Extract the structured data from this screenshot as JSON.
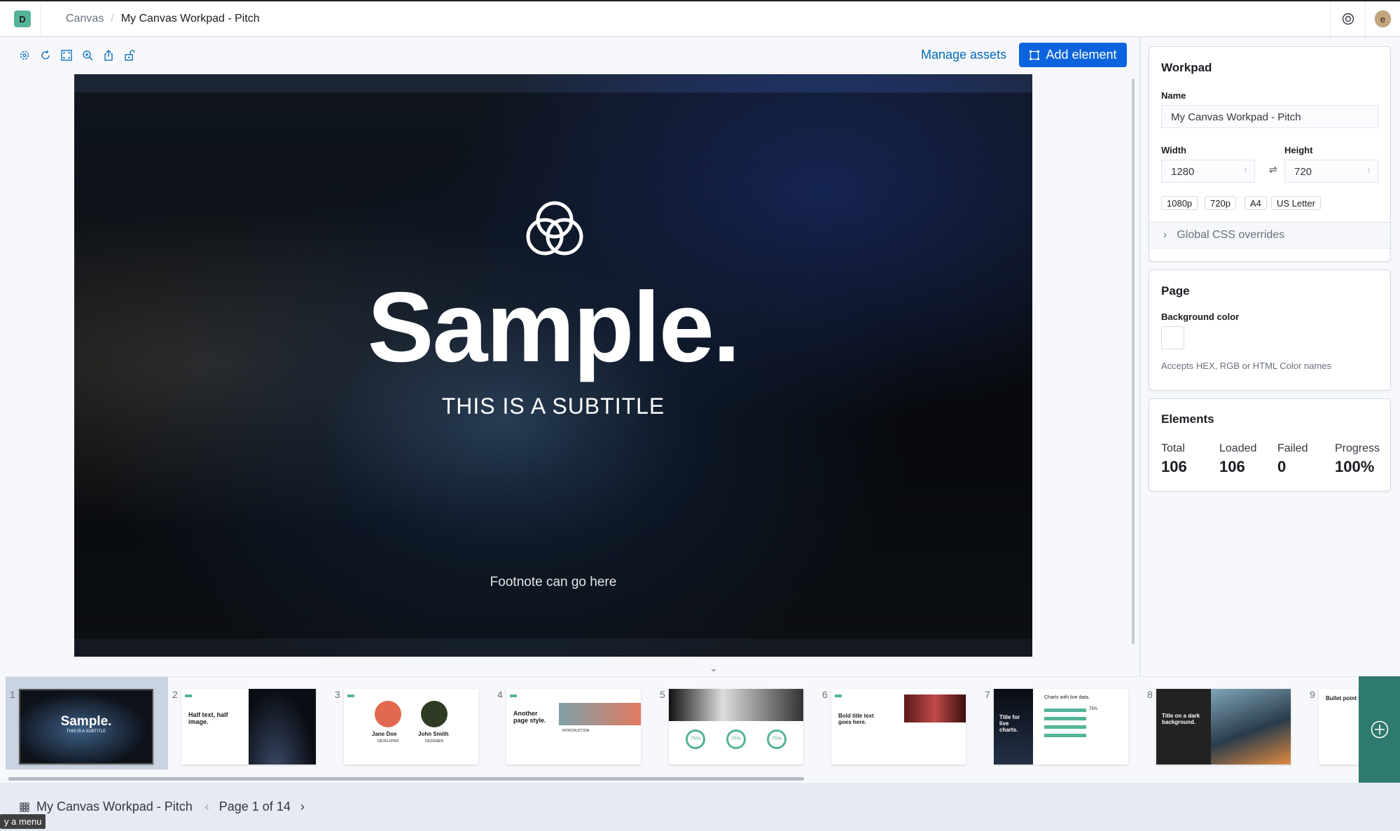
{
  "header": {
    "logo_letter": "D",
    "breadcrumbs": [
      "Canvas",
      "My Canvas Workpad - Pitch"
    ],
    "avatar_letter": "e"
  },
  "toolbar": {
    "icons": [
      "gear-icon",
      "refresh-icon",
      "fullscreen-icon",
      "zoom-in-icon",
      "share-icon",
      "lock-icon"
    ],
    "manage_assets": "Manage assets",
    "add_element": "Add element",
    "accent": "#0b64dd"
  },
  "slide": {
    "title": "Sample.",
    "subtitle": "THIS IS A SUBTITLE",
    "footnote": "Footnote can go here"
  },
  "workpad": {
    "title": "Workpad",
    "name_label": "Name",
    "name_value": "My Canvas Workpad - Pitch",
    "width_label": "Width",
    "width_value": "1280",
    "height_label": "Height",
    "height_value": "720",
    "presets": [
      "1080p",
      "720p",
      "A4",
      "US Letter"
    ],
    "css_overrides": "Global CSS overrides"
  },
  "page": {
    "title": "Page",
    "bg_label": "Background color",
    "bg_help": "Accepts HEX, RGB or HTML Color names",
    "bg_value": "#ffffff"
  },
  "elements": {
    "title": "Elements",
    "stats": [
      {
        "label": "Total",
        "value": "106"
      },
      {
        "label": "Loaded",
        "value": "106"
      },
      {
        "label": "Failed",
        "value": "0"
      },
      {
        "label": "Progress",
        "value": "100%"
      }
    ]
  },
  "pages": [
    {
      "num": "1",
      "title": "Sample.",
      "sub": "THIS IS A SUBTITLE"
    },
    {
      "num": "2",
      "title": "Half text, half image."
    },
    {
      "num": "3",
      "name1": "Jane Doe",
      "role1": "DEVELOPER",
      "name2": "John Smith",
      "role2": "DESIGNER"
    },
    {
      "num": "4",
      "title": "Another page style.",
      "sub": "INTRODUCTION"
    },
    {
      "num": "5",
      "stat": "75%"
    },
    {
      "num": "6",
      "title": "Bold title text goes here."
    },
    {
      "num": "7",
      "title": "Title for live charts.",
      "sub": "Charts with live data.",
      "stat": "75%"
    },
    {
      "num": "8",
      "title": "Title on a dark background."
    },
    {
      "num": "9",
      "title": "Bullet point la"
    }
  ],
  "footer": {
    "workpad_name": "My Canvas Workpad - Pitch",
    "page_indicator": "Page 1 of 14"
  },
  "tooltip": "y a menu",
  "colors": {
    "brand_teal": "#54b399",
    "add_page": "#2f7a6e"
  }
}
